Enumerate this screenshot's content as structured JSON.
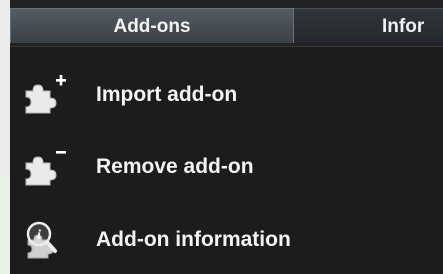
{
  "tabs": [
    {
      "label": "Add-ons",
      "active": true
    },
    {
      "label": "Infor",
      "active": false
    }
  ],
  "menu": {
    "items": [
      {
        "label": "Import add-on",
        "icon": "puzzle-plus-icon"
      },
      {
        "label": "Remove add-on",
        "icon": "puzzle-minus-icon"
      },
      {
        "label": "Add-on information",
        "icon": "puzzle-info-magnifier-icon"
      }
    ]
  },
  "colors": {
    "background": "#1c1c1c",
    "tab_active": "#4b5158",
    "text": "#f4f4f4"
  }
}
